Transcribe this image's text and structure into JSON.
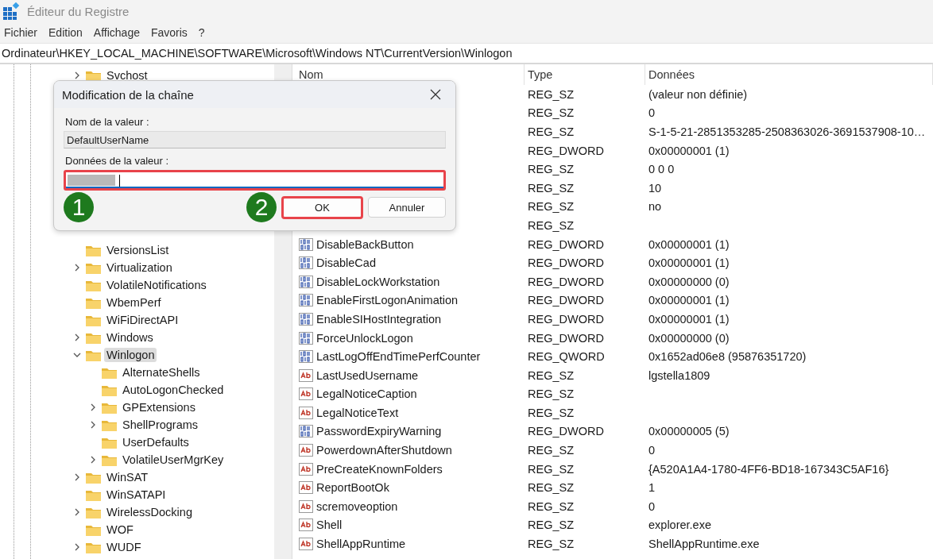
{
  "window": {
    "title": "Éditeur du Registre"
  },
  "menu": [
    "Fichier",
    "Edition",
    "Affichage",
    "Favoris",
    "?"
  ],
  "address": "Ordinateur\\HKEY_LOCAL_MACHINE\\SOFTWARE\\Microsoft\\Windows NT\\CurrentVersion\\Winlogon",
  "tree": {
    "top": [
      {
        "label": "Svchost",
        "kind": "collapsed",
        "selected": false
      }
    ],
    "items": [
      {
        "label": "VersionsList",
        "kind": "leaf",
        "selected": false
      },
      {
        "label": "Virtualization",
        "kind": "collapsed",
        "selected": false
      },
      {
        "label": "VolatileNotifications",
        "kind": "leaf",
        "selected": false
      },
      {
        "label": "WbemPerf",
        "kind": "leaf",
        "selected": false
      },
      {
        "label": "WiFiDirectAPI",
        "kind": "leaf",
        "selected": false
      },
      {
        "label": "Windows",
        "kind": "collapsed",
        "selected": false
      },
      {
        "label": "Winlogon",
        "kind": "expanded",
        "selected": true,
        "children": [
          {
            "label": "AlternateShells",
            "kind": "leaf",
            "selected": false
          },
          {
            "label": "AutoLogonChecked",
            "kind": "leaf",
            "selected": false
          },
          {
            "label": "GPExtensions",
            "kind": "collapsed",
            "selected": false
          },
          {
            "label": "ShellPrograms",
            "kind": "collapsed",
            "selected": false
          },
          {
            "label": "UserDefaults",
            "kind": "leaf",
            "selected": false
          },
          {
            "label": "VolatileUserMgrKey",
            "kind": "collapsed",
            "selected": false
          }
        ]
      },
      {
        "label": "WinSAT",
        "kind": "collapsed",
        "selected": false
      },
      {
        "label": "WinSATAPI",
        "kind": "leaf",
        "selected": false
      },
      {
        "label": "WirelessDocking",
        "kind": "collapsed",
        "selected": false
      },
      {
        "label": "WOF",
        "kind": "leaf",
        "selected": false
      },
      {
        "label": "WUDF",
        "kind": "collapsed",
        "selected": false
      }
    ]
  },
  "table": {
    "columns": [
      "Nom",
      "Type",
      "Données"
    ],
    "rows": [
      {
        "type": "REG_SZ",
        "data": "(valeur non définie)"
      },
      {
        "type": "REG_SZ",
        "data": "0"
      },
      {
        "type": "REG_SZ",
        "data": "S-1-5-21-2851353285-2508363026-3691537908-10…"
      },
      {
        "type": "REG_DWORD",
        "data": "0x00000001 (1)"
      },
      {
        "type": "REG_SZ",
        "data": "0 0 0"
      },
      {
        "type": "REG_SZ",
        "data": "10"
      },
      {
        "type": "REG_SZ",
        "data": "no"
      },
      {
        "type": "REG_SZ"
      },
      {
        "kind": "binary",
        "name": "DisableBackButton",
        "type": "REG_DWORD",
        "data": "0x00000001 (1)"
      },
      {
        "kind": "binary",
        "name": "DisableCad",
        "type": "REG_DWORD",
        "data": "0x00000001 (1)"
      },
      {
        "kind": "binary",
        "name": "DisableLockWorkstation",
        "type": "REG_DWORD",
        "data": "0x00000000 (0)"
      },
      {
        "kind": "binary",
        "name": "EnableFirstLogonAnimation",
        "type": "REG_DWORD",
        "data": "0x00000001 (1)"
      },
      {
        "kind": "binary",
        "name": "EnableSIHostIntegration",
        "type": "REG_DWORD",
        "data": "0x00000001 (1)"
      },
      {
        "kind": "binary",
        "name": "ForceUnlockLogon",
        "type": "REG_DWORD",
        "data": "0x00000000 (0)"
      },
      {
        "kind": "binary",
        "name": "LastLogOffEndTimePerfCounter",
        "type": "REG_QWORD",
        "data": "0x1652ad06e8 (95876351720)"
      },
      {
        "kind": "string",
        "name": "LastUsedUsername",
        "type": "REG_SZ",
        "data": "lgstella1809"
      },
      {
        "kind": "string",
        "name": "LegalNoticeCaption",
        "type": "REG_SZ"
      },
      {
        "kind": "string",
        "name": "LegalNoticeText",
        "type": "REG_SZ"
      },
      {
        "kind": "binary",
        "name": "PasswordExpiryWarning",
        "type": "REG_DWORD",
        "data": "0x00000005 (5)"
      },
      {
        "kind": "string",
        "name": "PowerdownAfterShutdown",
        "type": "REG_SZ",
        "data": "0"
      },
      {
        "kind": "string",
        "name": "PreCreateKnownFolders",
        "type": "REG_SZ",
        "data": "{A520A1A4-1780-4FF6-BD18-167343C5AF16}"
      },
      {
        "kind": "string",
        "name": "ReportBootOk",
        "type": "REG_SZ",
        "data": "1"
      },
      {
        "kind": "string",
        "name": "scremoveoption",
        "type": "REG_SZ",
        "data": "0"
      },
      {
        "kind": "string",
        "name": "Shell",
        "type": "REG_SZ",
        "data": "explorer.exe"
      },
      {
        "kind": "string",
        "name": "ShellAppRuntime",
        "type": "REG_SZ",
        "data": "ShellAppRuntime.exe"
      }
    ]
  },
  "dialog": {
    "title": "Modification de la chaîne",
    "name_label": "Nom de la valeur :",
    "name_value": "DefaultUserName",
    "data_label": "Données de la valeur :",
    "data_redacted": true,
    "steps": [
      "1",
      "2"
    ],
    "buttons": [
      {
        "label": "OK",
        "highlighted": true
      },
      {
        "label": "Annuler",
        "highlighted": false
      }
    ]
  }
}
